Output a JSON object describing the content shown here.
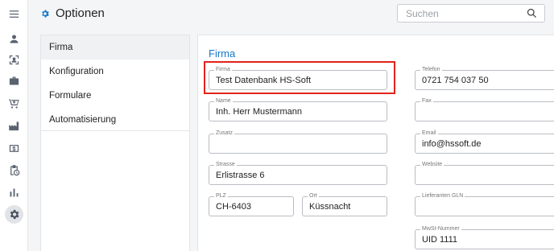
{
  "header": {
    "title": "Optionen",
    "search_placeholder": "Suchen"
  },
  "rail_icons": [
    "menu-icon",
    "person-icon",
    "scan-icon",
    "briefcase-icon",
    "cart-icon",
    "factory-icon",
    "dollar-icon",
    "clipboard-clock-icon",
    "bar-chart-icon",
    "gear-icon"
  ],
  "sidebar": {
    "items": [
      {
        "label": "Firma",
        "active": true
      },
      {
        "label": "Konfiguration"
      },
      {
        "label": "Formulare"
      },
      {
        "label": "Automatisierung"
      }
    ]
  },
  "form": {
    "section_title": "Firma",
    "firma": {
      "label": "Firma",
      "value": "Test Datenbank HS-Soft"
    },
    "name": {
      "label": "Name",
      "value": "Inh. Herr Mustermann"
    },
    "zusatz": {
      "label": "Zusatz",
      "value": ""
    },
    "strasse": {
      "label": "Strasse",
      "value": "Erlistrasse 6"
    },
    "plz": {
      "label": "PLZ",
      "value": "CH-6403"
    },
    "ort": {
      "label": "Ort",
      "value": "Küssnacht"
    },
    "telefon": {
      "label": "Telefon",
      "value": "0721 754 037 50"
    },
    "fax": {
      "label": "Fax",
      "value": ""
    },
    "email": {
      "label": "Email",
      "value": "info@hssoft.de"
    },
    "website": {
      "label": "Website",
      "value": ""
    },
    "lieferanten_gln": {
      "label": "Lieferanten GLN",
      "value": ""
    },
    "mwst": {
      "label": "MwSt-Nummer",
      "value": "UID 1111"
    }
  },
  "colors": {
    "accent": "#1677c8",
    "highlight": "#e0241c"
  }
}
